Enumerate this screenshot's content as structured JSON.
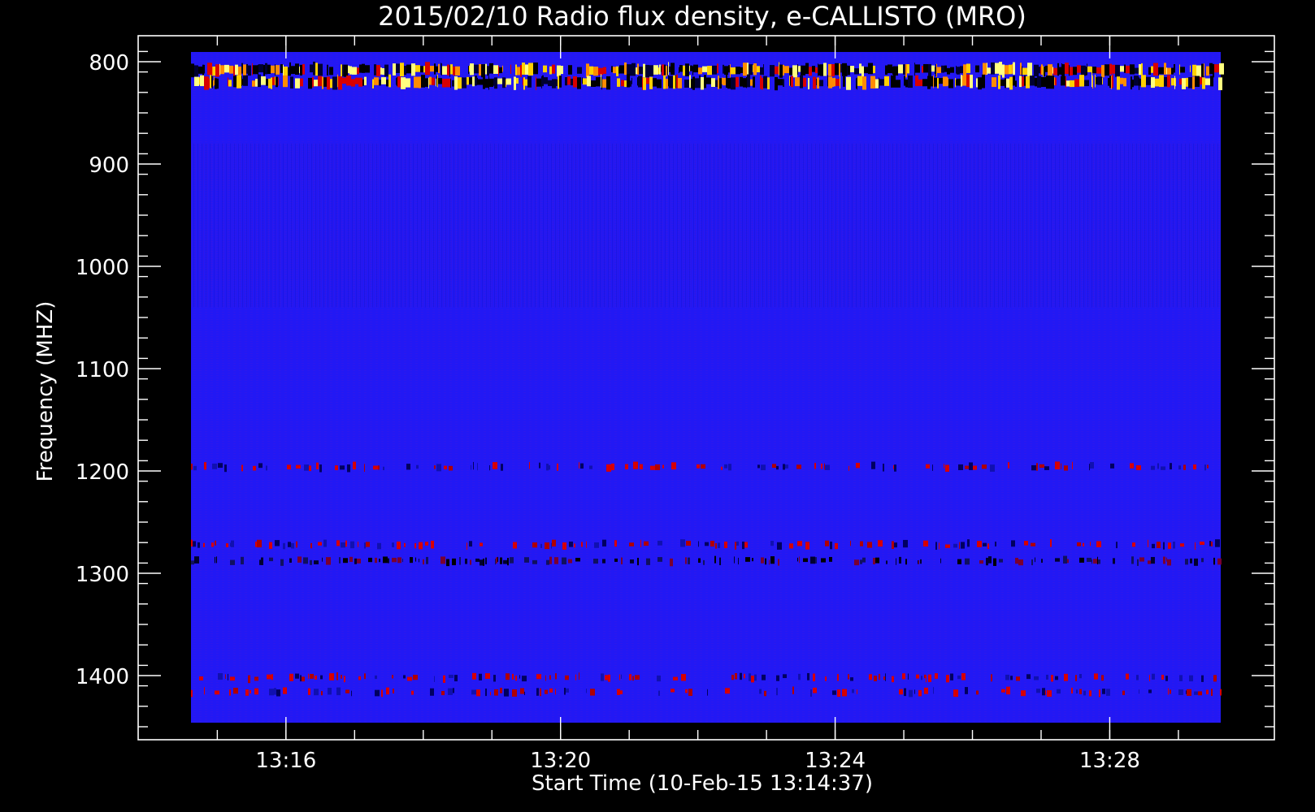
{
  "chart_data": {
    "type": "heatmap",
    "title": "2015/02/10  Radio flux density, e-CALLISTO (MRO)",
    "xlabel": "Start Time (10-Feb-15 13:14:37)",
    "ylabel": "Frequency (MHZ)",
    "x_unit": "UT time",
    "x_range": [
      "13:14:37",
      "13:29:37"
    ],
    "x_ticks": [
      "13:16",
      "13:20",
      "13:24",
      "13:28"
    ],
    "y_unit": "MHz",
    "y_range": [
      790,
      1450
    ],
    "y_ticks": [
      800,
      900,
      1000,
      1100,
      1200,
      1300,
      1400
    ],
    "y_inverted": true,
    "colormap": [
      "#000000",
      "#1f16ff",
      "#d80000",
      "#ff8c00",
      "#ffff80"
    ],
    "background_color": "#2218f4",
    "bands": [
      {
        "freq_mhz": 808,
        "level": "very high"
      },
      {
        "freq_mhz": 820,
        "level": "very high"
      },
      {
        "freq_mhz": 1196,
        "level": "medium"
      },
      {
        "freq_mhz": 1272,
        "level": "medium"
      },
      {
        "freq_mhz": 1288,
        "level": "low"
      },
      {
        "freq_mhz": 1402,
        "level": "medium"
      },
      {
        "freq_mhz": 1416,
        "level": "medium"
      }
    ]
  }
}
